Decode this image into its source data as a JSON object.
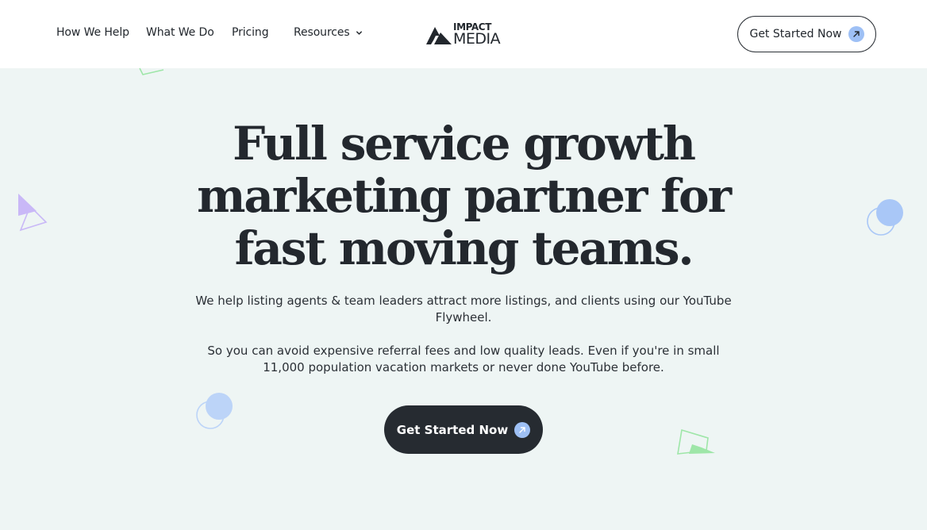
{
  "nav": {
    "items": [
      {
        "label": "How We Help"
      },
      {
        "label": "What We Do"
      },
      {
        "label": "Pricing"
      },
      {
        "label": "Resources"
      }
    ]
  },
  "logo": {
    "top": "IMPACT",
    "bottom": "MEDIA"
  },
  "header_cta": {
    "label": "Get Started Now",
    "icon": "arrow-up-right-icon"
  },
  "hero": {
    "title": "Full service growth marketing partner for fast moving teams.",
    "paragraph_1": "We help listing agents & team leaders attract more listings, and clients using our YouTube Flywheel.",
    "paragraph_2": "So you can avoid expensive referral fees and low quality leads. Even if you're in small 11,000 population vacation markets or never done YouTube before.",
    "cta_label": "Get Started Now"
  },
  "colors": {
    "background": "#eef5f4",
    "text": "#23282e",
    "button_dark": "#262b31",
    "accent_blue": "#9ec0f5",
    "accent_purple": "#c9b8f7",
    "accent_green": "#9ee6a8"
  }
}
